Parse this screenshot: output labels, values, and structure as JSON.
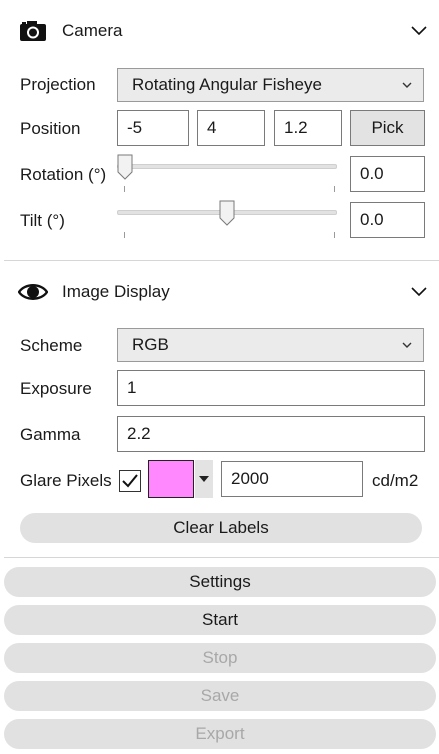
{
  "camera": {
    "title": "Camera",
    "icon": "camera-icon",
    "projection": {
      "label": "Projection",
      "value": "Rotating Angular Fisheye"
    },
    "position": {
      "label": "Position",
      "x": "-5",
      "y": "4",
      "z": "1.2",
      "pick_label": "Pick"
    },
    "rotation": {
      "label": "Rotation (°)",
      "value": "0.0",
      "slider_fraction": 0.0
    },
    "tilt": {
      "label": "Tilt (°)",
      "value": "0.0",
      "slider_fraction": 0.5
    }
  },
  "image_display": {
    "title": "Image Display",
    "icon": "eye-icon",
    "scheme": {
      "label": "Scheme",
      "value": "RGB"
    },
    "exposure": {
      "label": "Exposure",
      "value": "1"
    },
    "gamma": {
      "label": "Gamma",
      "value": "2.2"
    },
    "glare": {
      "label": "Glare Pixels",
      "checked": true,
      "color": "#ff88ff",
      "value": "2000",
      "unit": "cd/m2"
    },
    "clear_labels": "Clear Labels"
  },
  "actions": {
    "settings": "Settings",
    "start": "Start",
    "stop": "Stop",
    "save": "Save",
    "export": "Export"
  },
  "colors": {
    "button_bg": "#e1e1e1",
    "disabled_text": "#a8a8a8",
    "glare_swatch": "#ff88ff"
  }
}
